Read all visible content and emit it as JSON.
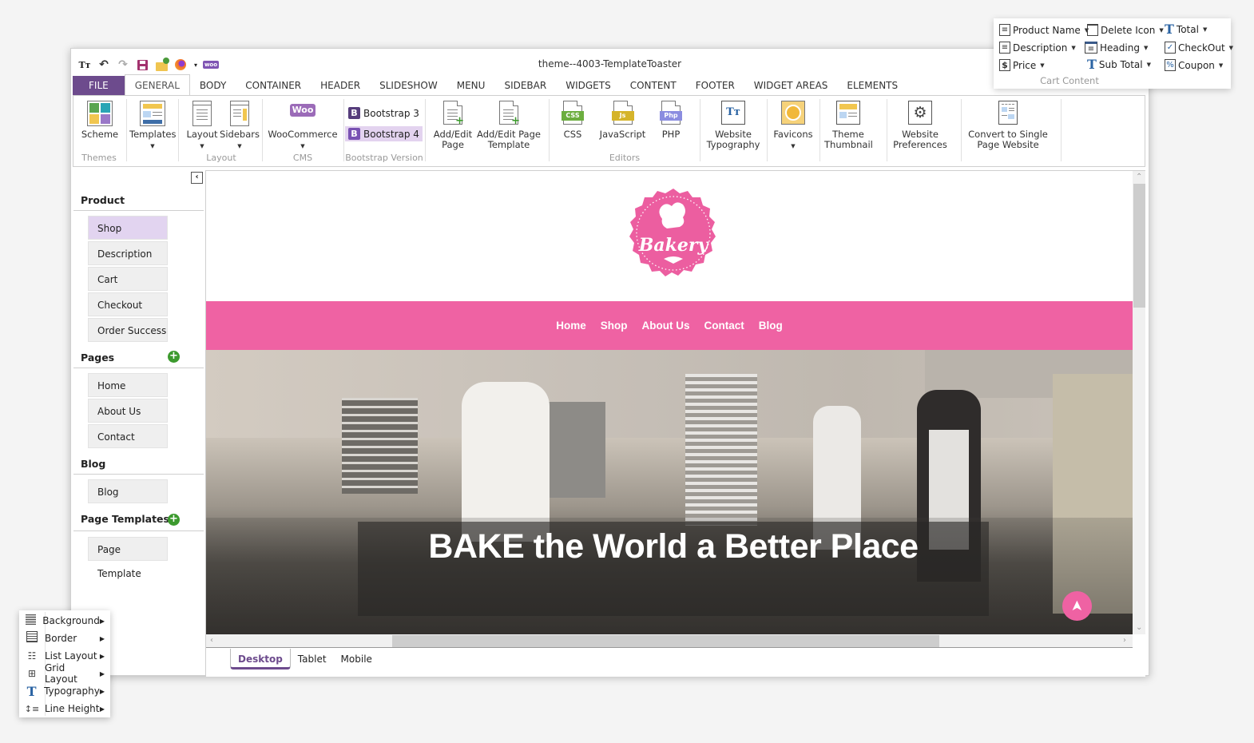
{
  "window": {
    "title": "theme--4003-TemplateToaster",
    "qat": [
      {
        "icon": "typography-icon",
        "glyph": "TT"
      },
      {
        "icon": "undo-icon",
        "glyph": "↶"
      },
      {
        "icon": "redo-icon",
        "glyph": "↷"
      },
      {
        "icon": "save-icon",
        "glyph": "💾"
      },
      {
        "icon": "open-folder-icon",
        "glyph": "📂"
      },
      {
        "icon": "firefox-icon",
        "glyph": "●"
      },
      {
        "icon": "dropdown-icon",
        "glyph": "▾"
      },
      {
        "icon": "woo-icon",
        "glyph": "woo"
      }
    ]
  },
  "ribbon": {
    "tabs": [
      "FILE",
      "GENERAL",
      "BODY",
      "CONTAINER",
      "HEADER",
      "SLIDESHOW",
      "MENU",
      "SIDEBAR",
      "WIDGETS",
      "CONTENT",
      "FOOTER",
      "WIDGET AREAS",
      "ELEMENTS"
    ],
    "active_tab": "GENERAL",
    "groups": {
      "themes": {
        "label": "Themes",
        "scheme": "Scheme"
      },
      "templates": {
        "label": "Templates"
      },
      "layout": {
        "label": "Layout",
        "layout": "Layout",
        "sidebars": "Sidebars"
      },
      "cms": {
        "label": "CMS",
        "woocommerce": "WooCommerce",
        "woo_badge": "Woo"
      },
      "bootstrap": {
        "label": "Bootstrap Version",
        "bs3": "Bootstrap 3",
        "bs4": "Bootstrap 4",
        "selected": "Bootstrap 4",
        "badge": "B"
      },
      "pages": {
        "add_edit_page_l1": "Add/Edit",
        "add_edit_page_l2": "Page",
        "add_edit_tpl_l1": "Add/Edit Page",
        "add_edit_tpl_l2": "Template"
      },
      "editors": {
        "label": "Editors",
        "css": "CSS",
        "js": "JavaScript",
        "php": "PHP",
        "css_tag": "CSS",
        "js_tag": "Js",
        "php_tag": "Php"
      },
      "typography": {
        "l1": "Website",
        "l2": "Typography"
      },
      "favicons": {
        "label": "Favicons"
      },
      "thumbnail": {
        "l1": "Theme",
        "l2": "Thumbnail"
      },
      "preferences": {
        "l1": "Website",
        "l2": "Preferences"
      },
      "convert": {
        "l1": "Convert to Single",
        "l2": "Page Website"
      }
    }
  },
  "cart_content": {
    "label": "Cart Content",
    "items": [
      {
        "label": "Product Name",
        "icon": "document-icon"
      },
      {
        "label": "Description",
        "icon": "document-icon"
      },
      {
        "label": "Price",
        "icon": "dollar-icon"
      },
      {
        "label": "Delete Icon",
        "icon": "trash-icon"
      },
      {
        "label": "Heading",
        "icon": "heading-icon"
      },
      {
        "label": "Sub Total",
        "icon": "text-icon"
      },
      {
        "label": "Total",
        "icon": "text-icon"
      },
      {
        "label": "CheckOut",
        "icon": "checkbox-icon"
      },
      {
        "label": "Coupon",
        "icon": "percent-icon"
      }
    ]
  },
  "sidebar": {
    "sections": [
      {
        "title": "Product",
        "items": [
          "Shop",
          "Description",
          "Cart",
          "Checkout",
          "Order Success"
        ],
        "selected": "Shop"
      },
      {
        "title": "Pages",
        "items": [
          "Home",
          "About Us",
          "Contact"
        ],
        "add": true
      },
      {
        "title": "Blog",
        "items": [
          "Blog"
        ]
      },
      {
        "title": "Page Templates",
        "items": [
          "Page Template"
        ],
        "add": true
      }
    ]
  },
  "site": {
    "logo_text": "Bakery",
    "nav": [
      "Home",
      "Shop",
      "About Us",
      "Contact",
      "Blog"
    ],
    "hero_title": "BAKE the World a Better Place",
    "accent": "#ef62a3"
  },
  "device_tabs": {
    "items": [
      "Desktop",
      "Tablet",
      "Mobile"
    ],
    "active": "Desktop"
  },
  "context_menu": {
    "items": [
      {
        "label": "Background",
        "icon": "background-icon"
      },
      {
        "label": "Border",
        "icon": "border-icon"
      },
      {
        "label": "List Layout",
        "icon": "list-layout-icon"
      },
      {
        "label": "Grid Layout",
        "icon": "grid-layout-icon"
      },
      {
        "label": "Typography",
        "icon": "typography-icon"
      },
      {
        "label": "Line Height",
        "icon": "line-height-icon"
      }
    ]
  },
  "colors": {
    "file_tab": "#6d4b8d",
    "bootstrap_selected": "#e3d3ef",
    "sidebar_selected": "#e2d4f0",
    "site_pink": "#ef62a3",
    "add_green": "#3c9a2e"
  }
}
